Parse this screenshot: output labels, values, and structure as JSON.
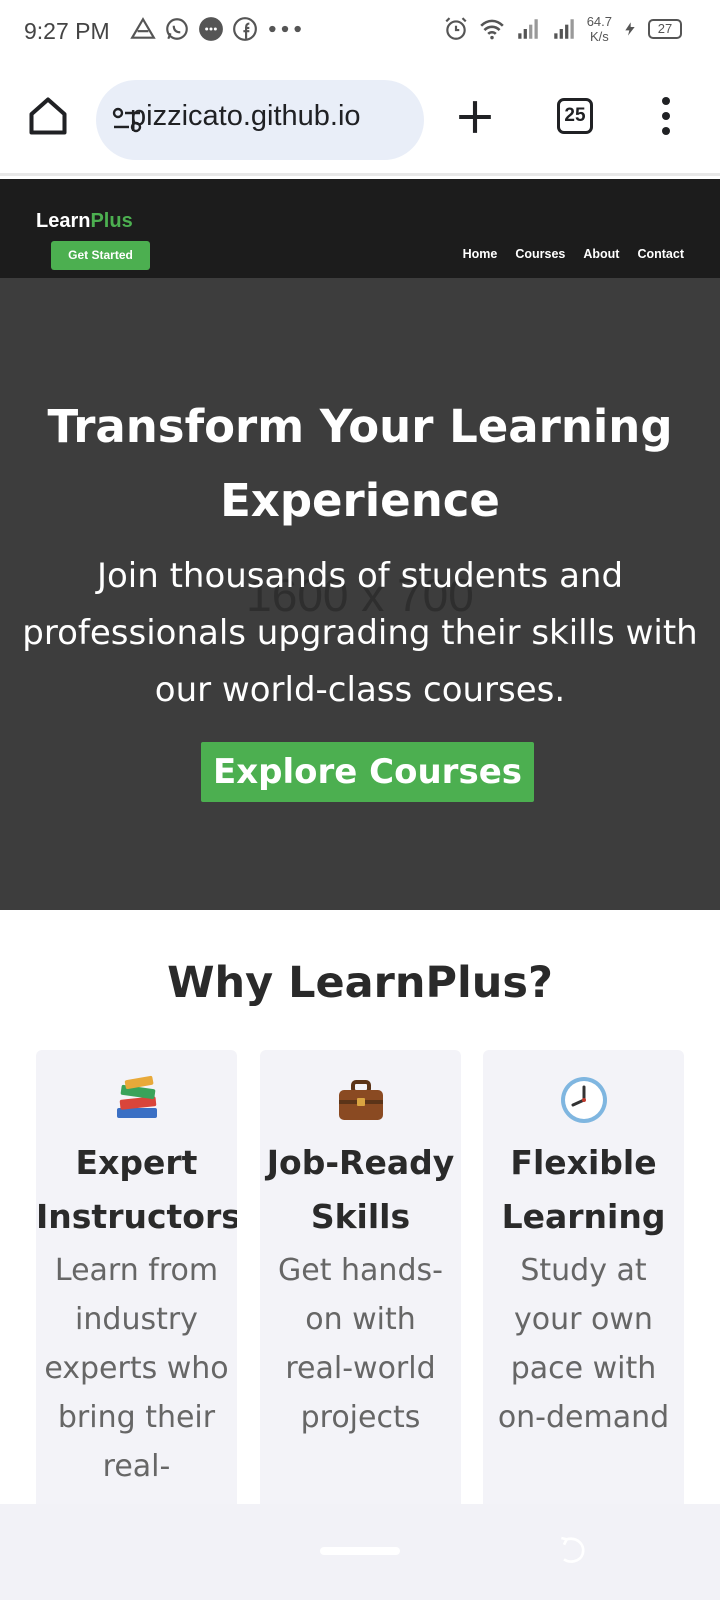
{
  "status_bar": {
    "time": "9:27 PM",
    "net_speed_value": "64.7",
    "net_speed_unit": "K/s",
    "battery": "27"
  },
  "browser": {
    "url": "pizzicato.github.io",
    "tab_count": "25"
  },
  "site": {
    "logo_primary": "Learn",
    "logo_accent": "Plus",
    "get_started": "Get Started",
    "nav": {
      "home": "Home",
      "courses": "Courses",
      "about": "About",
      "contact": "Contact"
    },
    "accent_color": "#4caf50"
  },
  "hero": {
    "placeholder": "1600 x 700",
    "title": "Transform Your Learning Experience",
    "subtitle": "Join thousands of students and professionals upgrading their skills with our world-class courses.",
    "cta": "Explore Courses"
  },
  "features": {
    "title": "Why LearnPlus?",
    "cards": [
      {
        "icon": "books-icon",
        "title": "Expert Instructors",
        "text": "Learn from industry experts who bring their real-"
      },
      {
        "icon": "briefcase-icon",
        "title": "Job-Ready Skills",
        "text": "Get hands-on with real-world projects"
      },
      {
        "icon": "clock-icon",
        "title": "Flexible Learning",
        "text": "Study at your own pace with on-demand"
      }
    ]
  }
}
